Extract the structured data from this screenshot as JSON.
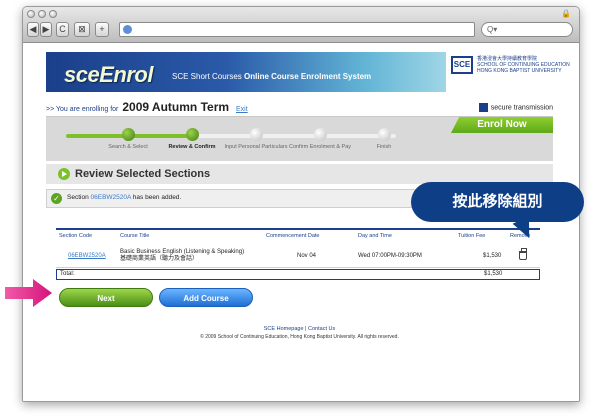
{
  "browser": {
    "nav_back": "◀",
    "nav_forward": "▶",
    "reload": "C",
    "share": "⊠",
    "new_tab": "+",
    "search_placeholder": "Q▾"
  },
  "header": {
    "logo": "sceEnrol",
    "system_title_prefix": "SCE Short Courses ",
    "system_title_bold": "Online Course Enrolment System",
    "school_mark": "SCE",
    "school_line1": "香港浸會大學持續教育學院",
    "school_line2": "SCHOOL OF CONTINUING EDUCATION",
    "school_line3": "HONG KONG BAPTIST UNIVERSITY"
  },
  "enrolment": {
    "prefix": ">> You are enrolling for",
    "term": "2009 Autumn Term",
    "exit_label": "Exit",
    "secure_label": "secure transmission",
    "enrol_now": "Enrol Now"
  },
  "steps": [
    {
      "label": "Search & Select",
      "done": true,
      "current": false
    },
    {
      "label": "Review & Confirm",
      "done": true,
      "current": true
    },
    {
      "label": "Input Personal Particulars",
      "done": false,
      "current": false
    },
    {
      "label": "Confirm Enrolment & Pay",
      "done": false,
      "current": false
    },
    {
      "label": "Finish",
      "done": false,
      "current": false
    }
  ],
  "review": {
    "title": "Review Selected Sections",
    "added_prefix": "Section",
    "added_code": "06EBW2520A",
    "added_suffix": "has been added."
  },
  "table": {
    "headers": [
      "Section Code",
      "Course Title",
      "Commencement Date",
      "Day and Time",
      "Tuition Fee",
      "Remove"
    ],
    "rows": [
      {
        "section_code": "06EBW2520A",
        "title_en": "Basic Business English (Listening & Speaking)",
        "title_zh": "基礎商業英語（聽力及會話）",
        "commencement": "Nov 04",
        "day_time": "Wed 07:00PM-09:30PM",
        "fee": "$1,530"
      }
    ],
    "total_label": "Total:",
    "total_value": "$1,530"
  },
  "buttons": {
    "next": "Next",
    "add_course": "Add Course"
  },
  "footer": {
    "homepage": "SCE Homepage",
    "separator": "|",
    "contact": "Contact Us",
    "copyright": "© 2009 School of Continuing Education, Hong Kong Baptist University. All rights reserved."
  },
  "annotation": {
    "callout_text": "按此移除組別"
  },
  "colors": {
    "brand_blue": "#1b3f8a",
    "accent_green": "#5ea81a",
    "button_blue": "#1f6fd6",
    "arrow_magenta": "#e0218a"
  },
  "icons": [
    "globe-icon",
    "lock-icon",
    "play-icon",
    "check-icon",
    "trash-icon",
    "arrow-icon"
  ]
}
